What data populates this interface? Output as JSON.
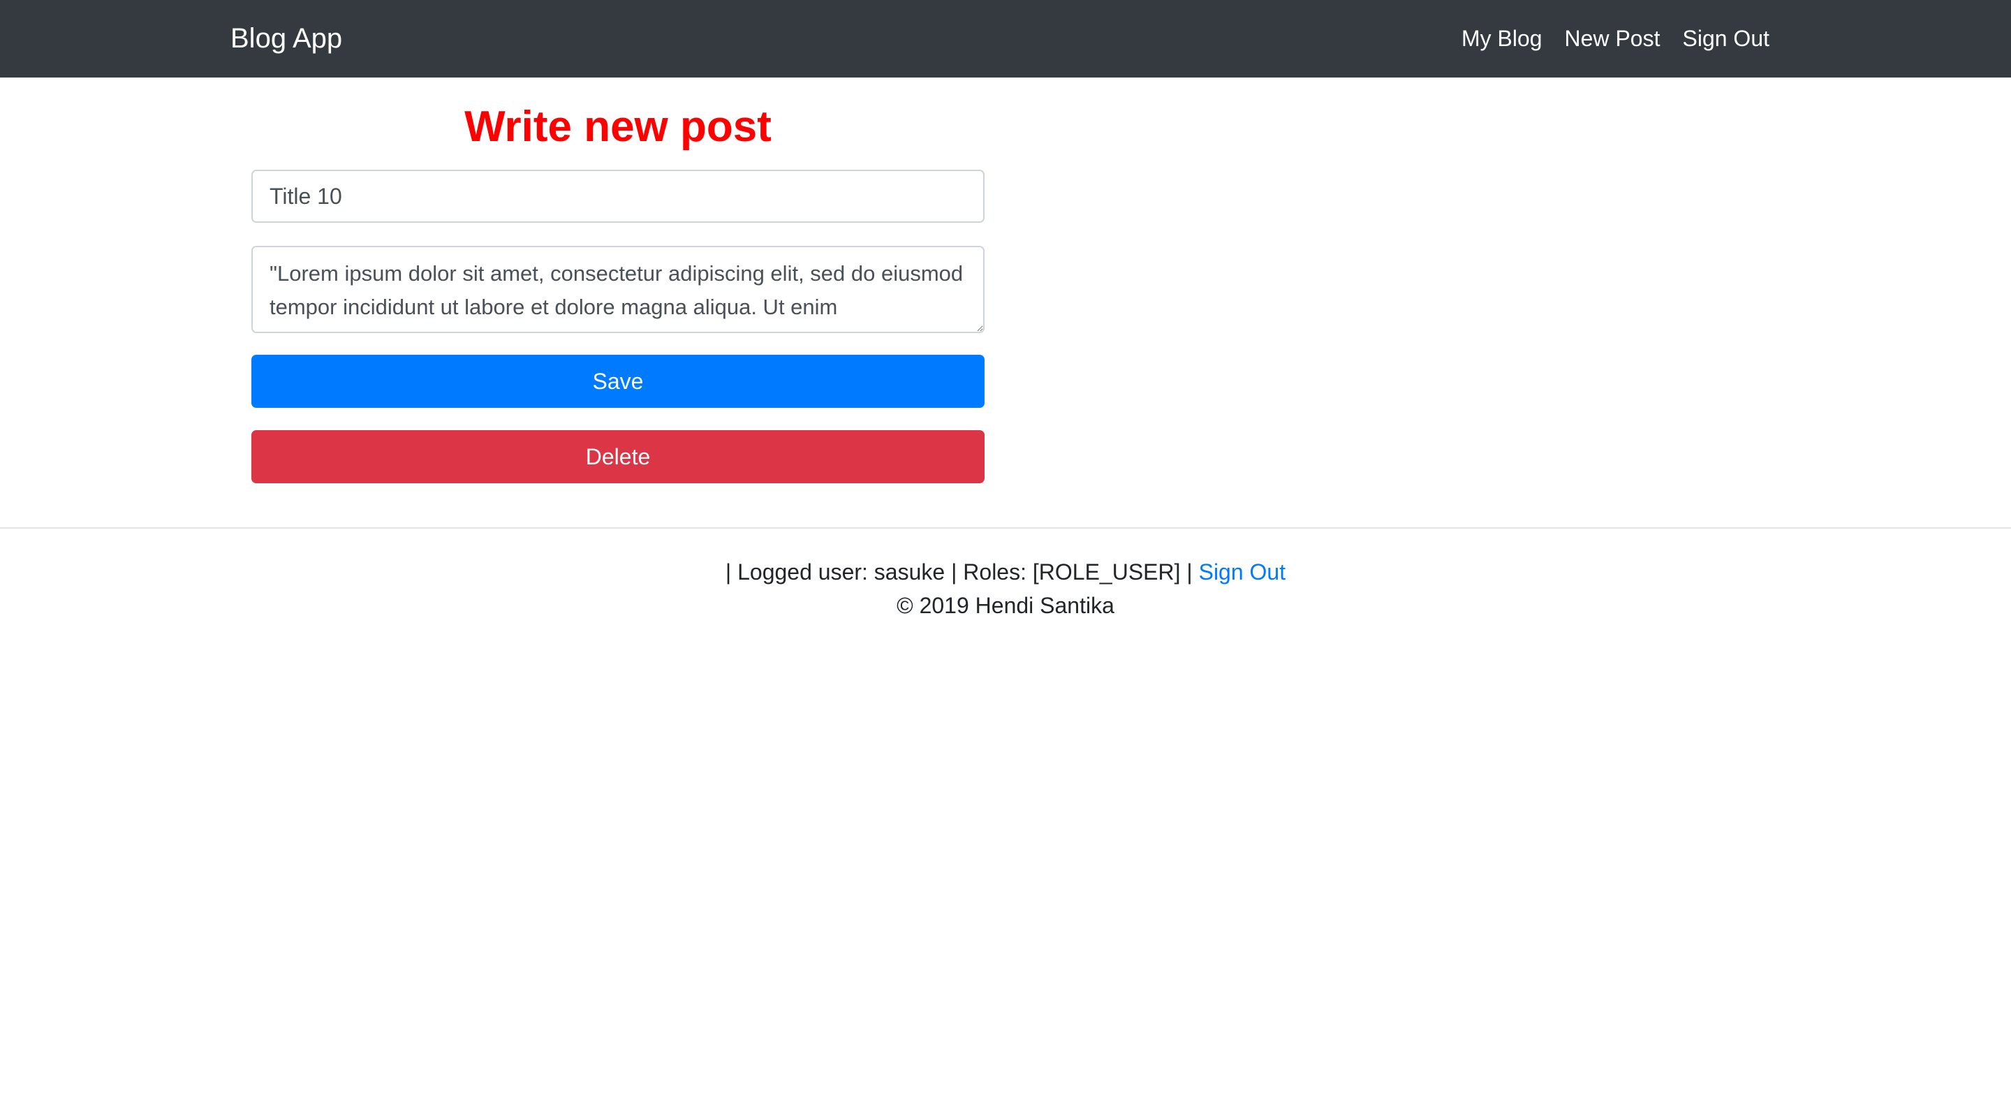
{
  "navbar": {
    "brand": "Blog App",
    "links": [
      "My Blog",
      "New Post",
      "Sign Out"
    ]
  },
  "form": {
    "heading": "Write new post",
    "title_value": "Title 10",
    "body_value": "\"Lorem ipsum dolor sit amet, consectetur adipiscing elit, sed do eiusmod tempor incididunt ut labore et dolore magna aliqua. Ut enim",
    "save_label": "Save",
    "delete_label": "Delete"
  },
  "footer": {
    "user_prefix": "| Logged user: ",
    "username": "sasuke",
    "roles_prefix": " | Roles: ",
    "roles": "[ROLE_USER]",
    "separator": " | ",
    "signout_label": "Sign Out",
    "copyright": "© 2019 Hendi Santika"
  },
  "colors": {
    "navbar_bg": "#343a40",
    "heading": "#ff0000",
    "primary": "#007bff",
    "danger": "#dc3545"
  }
}
